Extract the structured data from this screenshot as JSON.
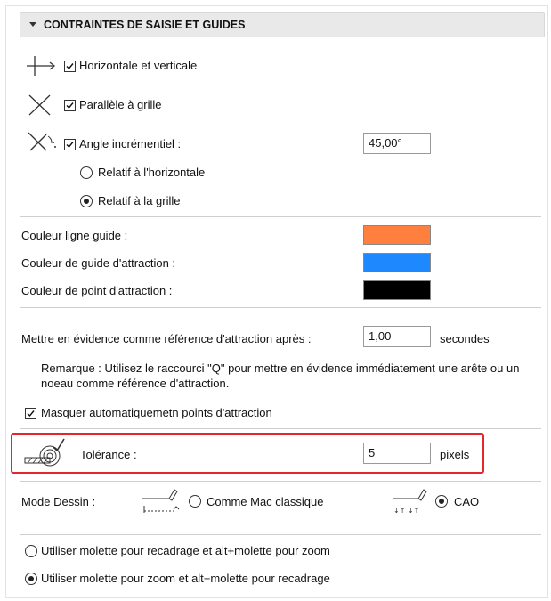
{
  "section": {
    "title": "CONTRAINTES DE SAISIE ET GUIDES"
  },
  "horizontal_vertical": {
    "label": "Horizontale et verticale",
    "checked": true
  },
  "parallel_grid": {
    "label": "Parallèle à grille",
    "checked": true
  },
  "incremental_angle": {
    "label": "Angle incrémentiel :",
    "checked": true,
    "value": "45,00°"
  },
  "relative_horizontal": {
    "label": "Relatif à l'horizontale",
    "selected": false
  },
  "relative_grid": {
    "label": "Relatif à la grille",
    "selected": true
  },
  "colors": {
    "guide_line_label": "Couleur ligne guide :",
    "guide_line_color": "#ff7f3f",
    "attraction_guide_label": "Couleur de guide d'attraction :",
    "attraction_guide_color": "#1e88ff",
    "attraction_point_label": "Couleur de point d'attraction :",
    "attraction_point_color": "#000000"
  },
  "highlight_after": {
    "label": "Mettre en évidence comme référence d'attraction après :",
    "value": "1,00",
    "unit": "secondes"
  },
  "note": "Remarque : Utilisez le raccourci \"Q\" pour mettre en évidence immédiatement une arête ou un noeau comme référence d'attraction.",
  "auto_hide": {
    "label": "Masquer automatiquemetn points d'attraction",
    "checked": true
  },
  "tolerance": {
    "label": "Tolérance :",
    "value": "5",
    "unit": "pixels"
  },
  "draw_mode": {
    "label": "Mode Dessin :",
    "mac_classic": {
      "label": "Comme Mac classique",
      "selected": false
    },
    "cad": {
      "label": "CAO",
      "selected": true
    }
  },
  "wheel_option_1": {
    "label": "Utiliser molette pour recadrage et alt+molette pour zoom",
    "selected": false
  },
  "wheel_option_2": {
    "label": "Utiliser molette pour zoom et alt+molette pour recadrage",
    "selected": true
  }
}
